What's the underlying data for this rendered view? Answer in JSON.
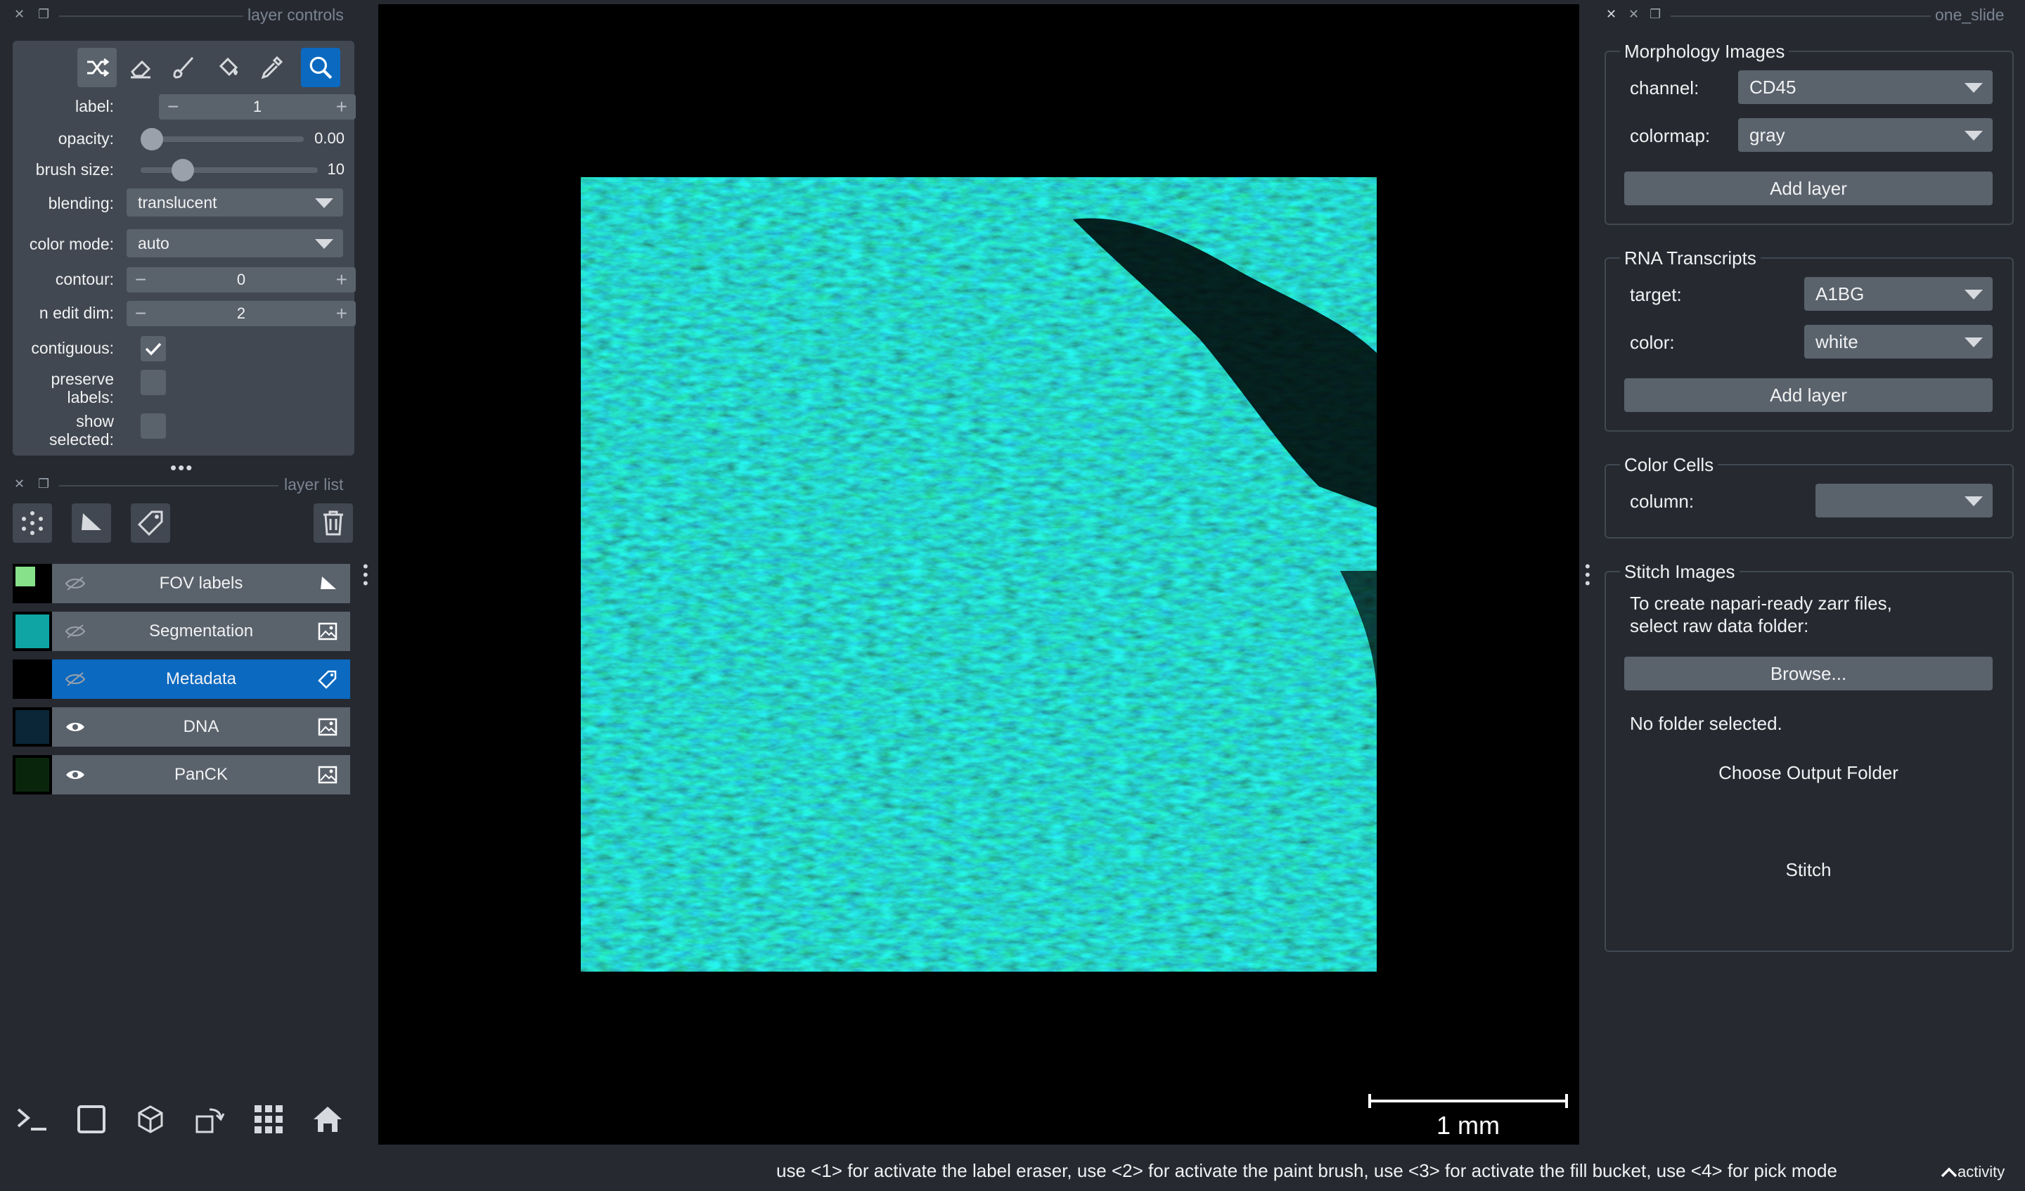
{
  "layer_controls": {
    "dock_title": "layer controls",
    "label": {
      "name": "label:",
      "value": "1"
    },
    "opacity": {
      "name": "opacity:",
      "value": "0.00",
      "level": 0.0
    },
    "brush_size": {
      "name": "brush size:",
      "value": "10",
      "level": 0.2
    },
    "blending": {
      "name": "blending:",
      "value": "translucent"
    },
    "color_mode": {
      "name": "color mode:",
      "value": "auto"
    },
    "contour": {
      "name": "contour:",
      "value": "0"
    },
    "n_edit_dim": {
      "name": "n edit dim:",
      "value": "2"
    },
    "contiguous": {
      "name": "contiguous:",
      "checked": true
    },
    "preserve_labels": {
      "name_1": "preserve",
      "name_2": "labels:",
      "checked": false
    },
    "show_selected": {
      "name_1": "show",
      "name_2": "selected:",
      "checked": false
    },
    "tools": [
      "shuffle-icon",
      "eraser-icon",
      "paint-brush-icon",
      "fill-bucket-icon",
      "color-picker-icon",
      "zoom-icon"
    ]
  },
  "layer_list": {
    "dock_title": "layer list",
    "layers": [
      {
        "name": "FOV labels",
        "type": "shapes",
        "visible": false,
        "selected": false,
        "thumb_color": "#86e18a"
      },
      {
        "name": "Segmentation",
        "type": "image",
        "visible": false,
        "selected": false,
        "thumb_color": "#0fa5a5"
      },
      {
        "name": "Metadata",
        "type": "labels",
        "visible": false,
        "selected": true,
        "thumb_color": "#000000"
      },
      {
        "name": "DNA",
        "type": "image",
        "visible": true,
        "selected": false,
        "thumb_color": "#0b2a3d"
      },
      {
        "name": "PanCK",
        "type": "image",
        "visible": true,
        "selected": false,
        "thumb_color": "#0a2a0e"
      }
    ]
  },
  "canvas": {
    "scale_bar": "1 mm"
  },
  "right_dock": {
    "dock_title": "one_slide",
    "morphology": {
      "title": "Morphology Images",
      "channel_label": "channel:",
      "channel_value": "CD45",
      "colormap_label": "colormap:",
      "colormap_value": "gray",
      "add_button": "Add layer"
    },
    "rna": {
      "title": "RNA Transcripts",
      "target_label": "target:",
      "target_value": "A1BG",
      "color_label": "color:",
      "color_value": "white",
      "add_button": "Add layer"
    },
    "color_cells": {
      "title": "Color Cells",
      "column_label": "column:",
      "column_value": ""
    },
    "stitch": {
      "title": "Stitch Images",
      "instructions_1": "To create napari-ready zarr files,",
      "instructions_2": "select raw data folder:",
      "browse_button": "Browse...",
      "folder_status": "No folder selected.",
      "output_button": "Choose Output Folder",
      "stitch_button": "Stitch"
    }
  },
  "status_bar": {
    "message": "use <1> for activate the label eraser, use <2> for activate the paint brush, use <3> for activate the fill bucket, use <4> for pick mode",
    "activity": "activity"
  },
  "colors": {
    "background": "#262930",
    "panel": "#414851",
    "widget": "#5a626c",
    "accent": "#0b69c0"
  }
}
